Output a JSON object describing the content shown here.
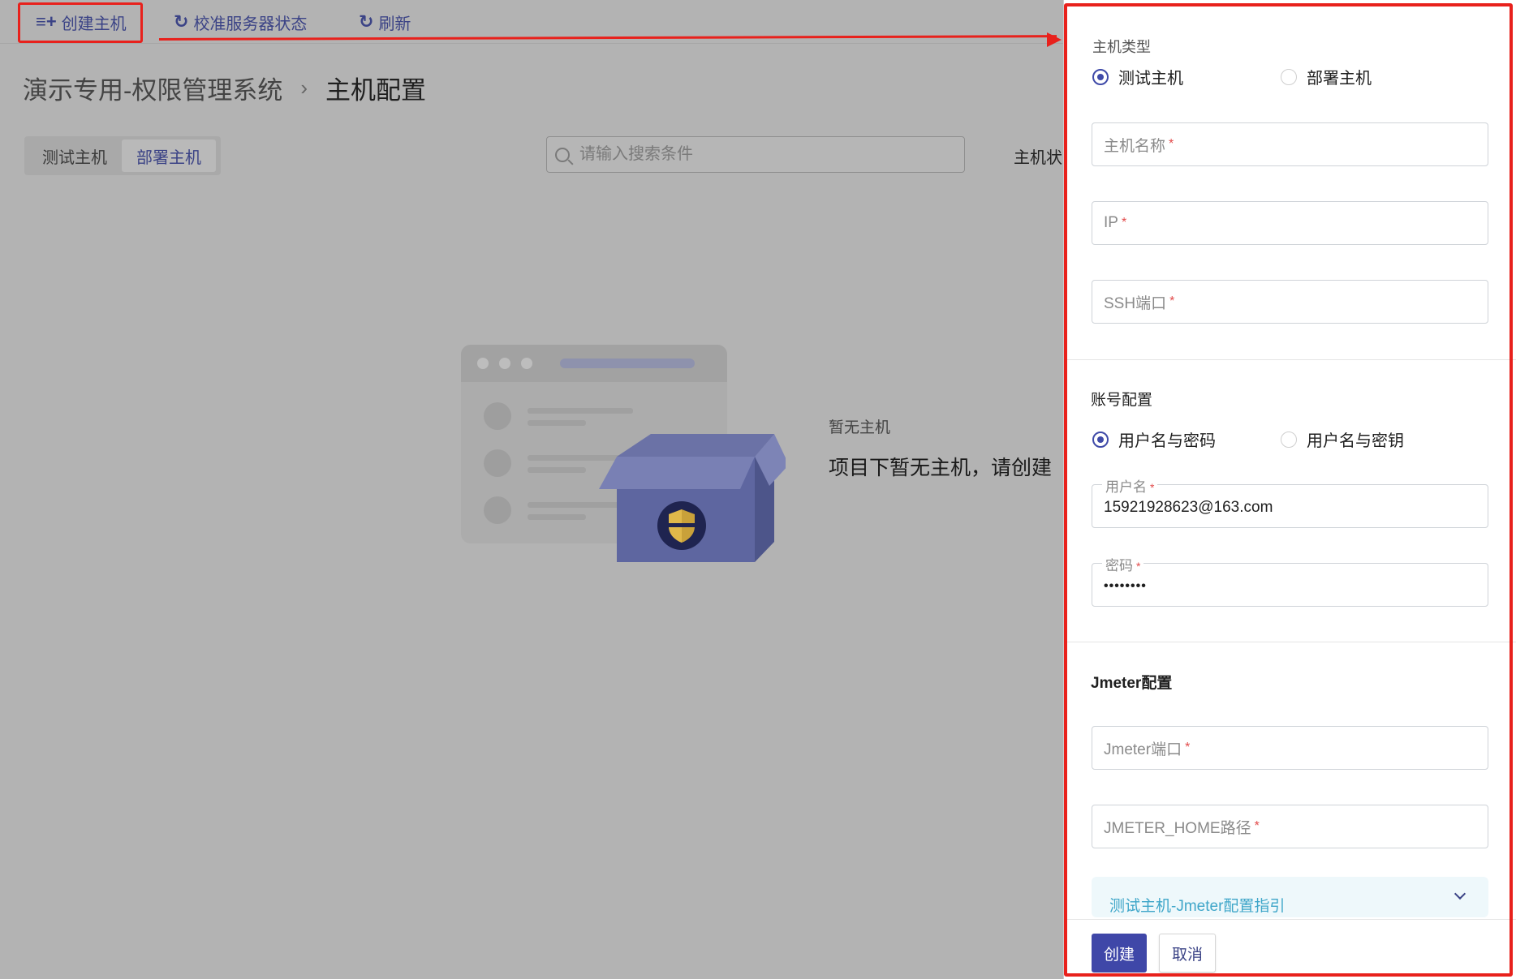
{
  "toolbar": {
    "create_host": "创建主机",
    "calibrate_status": "校准服务器状态",
    "refresh": "刷新"
  },
  "breadcrumb": {
    "project": "演示专用-权限管理系统",
    "page": "主机配置"
  },
  "tabs": [
    "测试主机",
    "部署主机"
  ],
  "active_tab": "部署主机",
  "search": {
    "placeholder": "请输入搜索条件"
  },
  "status_filter_label": "主机状",
  "empty": {
    "title": "暂无主机",
    "description": "项目下暂无主机，请创建"
  },
  "drawer": {
    "host_type": {
      "label": "主机类型",
      "options": [
        "测试主机",
        "部署主机"
      ],
      "selected": "测试主机"
    },
    "fields": {
      "host_name": "主机名称",
      "ip": "IP",
      "ssh_port": "SSH端口"
    },
    "account": {
      "title": "账号配置",
      "options": [
        "用户名与密码",
        "用户名与密钥"
      ],
      "selected": "用户名与密码",
      "username_label": "用户名",
      "username_value": "15921928623@163.com",
      "password_label": "密码",
      "password_value": "••••••••"
    },
    "jmeter": {
      "title": "Jmeter配置",
      "port": "Jmeter端口",
      "home_path": "JMETER_HOME路径",
      "guide": "测试主机-Jmeter配置指引"
    },
    "required_mark": "*",
    "submit": "创建",
    "cancel": "取消"
  },
  "colors": {
    "primary": "#3f47a8",
    "annotation_red": "#e8211c",
    "overlay": "#b3b3b3",
    "guide_text": "#3fa6c9"
  }
}
